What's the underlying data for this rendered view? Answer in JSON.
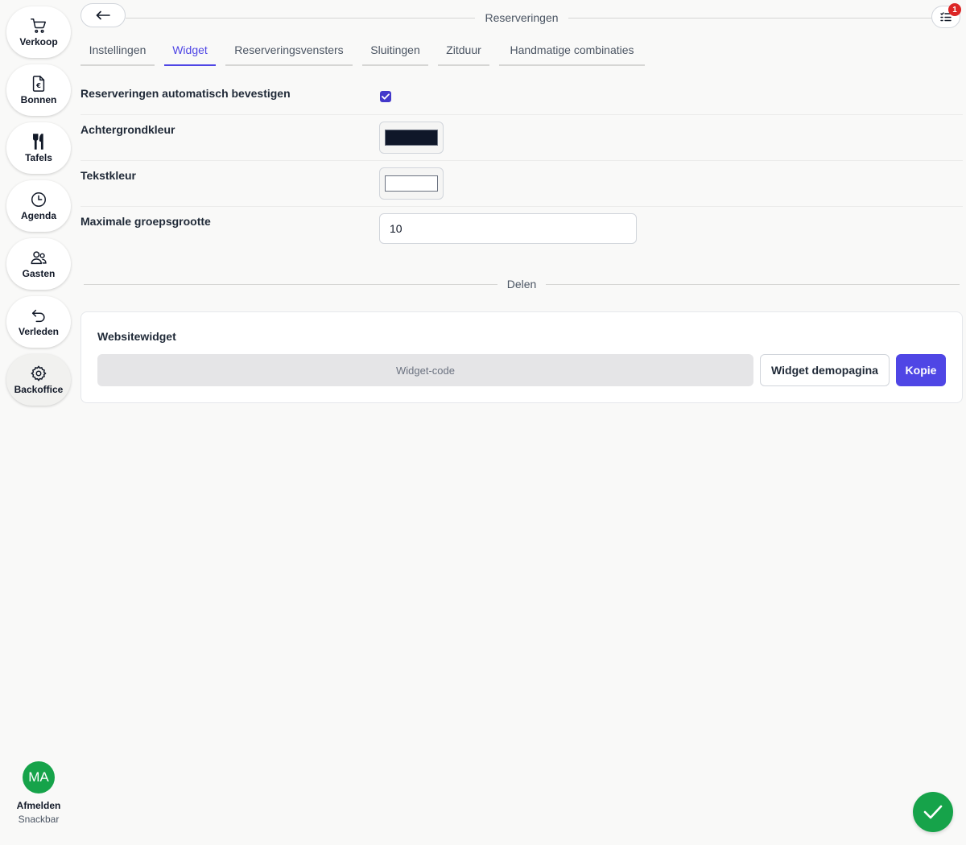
{
  "sidebar": {
    "items": [
      {
        "label": "Verkoop",
        "icon": "cart-icon"
      },
      {
        "label": "Bonnen",
        "icon": "receipt-icon"
      },
      {
        "label": "Tafels",
        "icon": "cutlery-icon"
      },
      {
        "label": "Agenda",
        "icon": "clock-icon"
      },
      {
        "label": "Gasten",
        "icon": "users-icon"
      },
      {
        "label": "Verleden",
        "icon": "undo-icon"
      },
      {
        "label": "Backoffice",
        "icon": "gear-icon"
      }
    ],
    "user": {
      "initials": "MA",
      "logout_label": "Afmelden",
      "location": "Snackbar"
    }
  },
  "header": {
    "title": "Reserveringen",
    "notification_count": "1"
  },
  "tabs": [
    {
      "label": "Instellingen",
      "active": false
    },
    {
      "label": "Widget",
      "active": true
    },
    {
      "label": "Reserveringsvensters",
      "active": false
    },
    {
      "label": "Sluitingen",
      "active": false
    },
    {
      "label": "Zitduur",
      "active": false
    },
    {
      "label": "Handmatige combinaties",
      "active": false
    }
  ],
  "settings": {
    "auto_confirm": {
      "label": "Reserveringen automatisch bevestigen",
      "checked": true
    },
    "background_color": {
      "label": "Achtergrondkleur",
      "value": "#0f1729"
    },
    "text_color": {
      "label": "Tekstkleur",
      "value": "#ffffff"
    },
    "max_group_size": {
      "label": "Maximale groepsgrootte",
      "value": "10"
    }
  },
  "share": {
    "section_title": "Delen",
    "card_title": "Websitewidget",
    "code_button": "Widget-code",
    "demo_button": "Widget demopagina",
    "copy_button": "Kopie"
  },
  "colors": {
    "accent": "#4f46e5",
    "success": "#16a34a",
    "badge": "#dc2626"
  }
}
